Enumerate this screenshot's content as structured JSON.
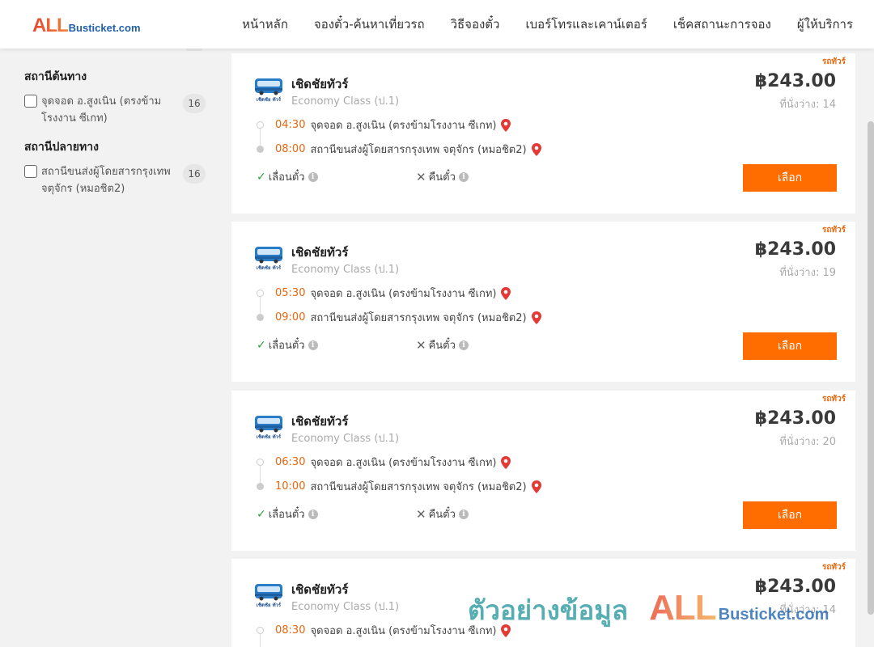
{
  "header": {
    "logo_all": "ALL",
    "logo_rest": "Busticket.com",
    "nav": [
      "หน้าหลัก",
      "จองตั๋ว-ค้นหาเที่ยวรถ",
      "วิธีจองตั๋ว",
      "เบอร์โทรและเคาน์เตอร์",
      "เช็คสถานะการจอง",
      "ผู้ให้บริการ"
    ]
  },
  "sidebar": {
    "origin": {
      "title": "สถานีต้นทาง",
      "options": [
        {
          "label": "จุดจอด อ.สูงเนิน (ตรงข้ามโรงงาน ซีเกท)",
          "count": "16"
        }
      ]
    },
    "destination": {
      "title": "สถานีปลายทาง",
      "options": [
        {
          "label": "สถานีขนส่งผู้โดยสารกรุงเทพ จตุจักร (หมอชิต2)",
          "count": "16"
        }
      ]
    }
  },
  "trips": [
    {
      "tag": "รถทัวร์",
      "operator": "เชิดชัยทัวร์",
      "class": "Economy Class (ป.1)",
      "price": "฿243.00",
      "seats": "ที่นั่งว่าง: 14",
      "depart_time": "04:30",
      "depart_stop": "จุดจอด อ.สูงเนิน (ตรงข้ามโรงงาน ซีเกท)",
      "arrive_time": "08:00",
      "arrive_stop": "สถานีขนส่งผู้โดยสารกรุงเทพ จตุจักร (หมอชิต2)",
      "reschedule": "เลื่อนตั๋ว",
      "refund": "คืนตั๋ว",
      "select": "เลือก"
    },
    {
      "tag": "รถทัวร์",
      "operator": "เชิดชัยทัวร์",
      "class": "Economy Class (ป.1)",
      "price": "฿243.00",
      "seats": "ที่นั่งว่าง: 19",
      "depart_time": "05:30",
      "depart_stop": "จุดจอด อ.สูงเนิน (ตรงข้ามโรงงาน ซีเกท)",
      "arrive_time": "09:00",
      "arrive_stop": "สถานีขนส่งผู้โดยสารกรุงเทพ จตุจักร (หมอชิต2)",
      "reschedule": "เลื่อนตั๋ว",
      "refund": "คืนตั๋ว",
      "select": "เลือก"
    },
    {
      "tag": "รถทัวร์",
      "operator": "เชิดชัยทัวร์",
      "class": "Economy Class (ป.1)",
      "price": "฿243.00",
      "seats": "ที่นั่งว่าง: 20",
      "depart_time": "06:30",
      "depart_stop": "จุดจอด อ.สูงเนิน (ตรงข้ามโรงงาน ซีเกท)",
      "arrive_time": "10:00",
      "arrive_stop": "สถานีขนส่งผู้โดยสารกรุงเทพ จตุจักร (หมอชิต2)",
      "reschedule": "เลื่อนตั๋ว",
      "refund": "คืนตั๋ว",
      "select": "เลือก"
    },
    {
      "tag": "รถทัวร์",
      "operator": "เชิดชัยทัวร์",
      "class": "Economy Class (ป.1)",
      "price": "฿243.00",
      "seats": "ที่นั่งว่าง: 14",
      "depart_time": "08:30",
      "depart_stop": "จุดจอด อ.สูงเนิน (ตรงข้ามโรงงาน ซีเกท)"
    }
  ],
  "watermark": {
    "text": "ตัวอย่างข้อมูล",
    "all": "ALL",
    "rest": "Busticket.com"
  },
  "colors": {
    "accent": "#ff6d00",
    "time": "#e8660d",
    "pin": "#e53935",
    "check": "#2e9e3a"
  },
  "icons": {
    "pin": "map-pin-icon",
    "check": "check-icon",
    "cross": "x-icon",
    "info": "info-icon",
    "bus": "bus-logo-icon"
  }
}
